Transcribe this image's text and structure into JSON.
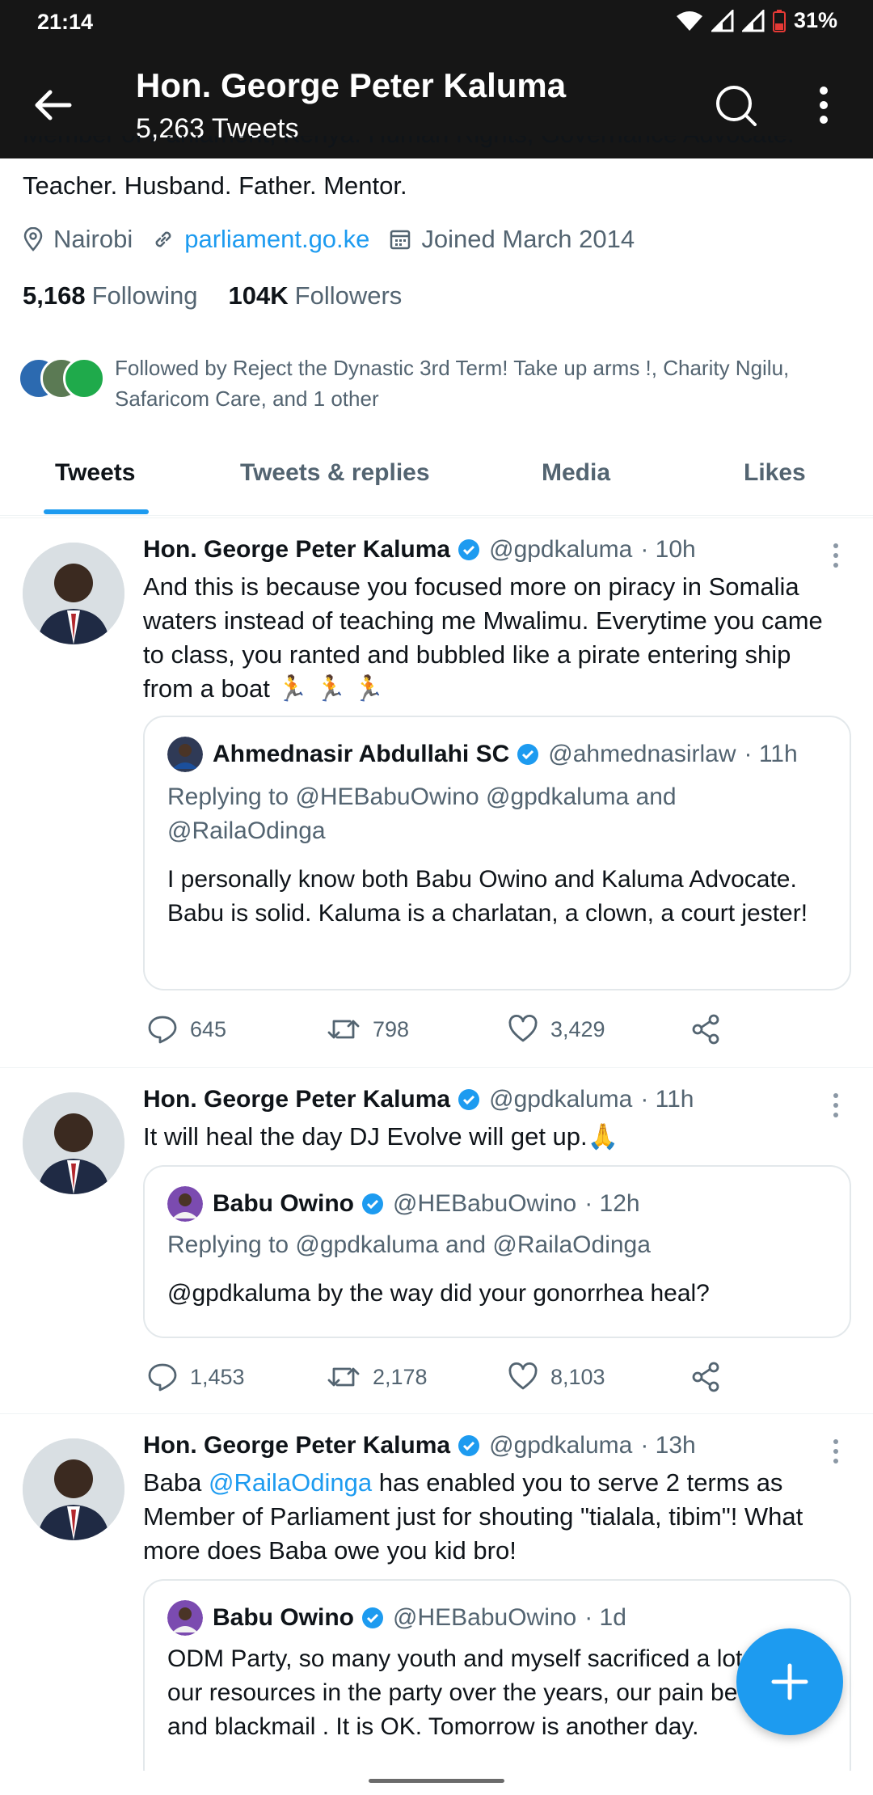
{
  "status_bar": {
    "time": "21:14",
    "battery": "31%"
  },
  "header": {
    "title": "Hon. George Peter Kaluma",
    "subtitle": "5,263 Tweets"
  },
  "profile": {
    "bio_partial": "Member of Parliament, Kenya. Human Rights, Governance Advocate.",
    "bio_line": "Teacher. Husband. Father. Mentor.",
    "location": "Nairobi",
    "website": "parliament.go.ke",
    "joined": "Joined March 2014",
    "following_count": "5,168",
    "following_label": "Following",
    "followers_count": "104K",
    "followers_label": "Followers",
    "followed_by": "Followed by Reject the Dynastic 3rd Term! Take up arms !, Charity Ngilu, Safaricom Care, and 1 other"
  },
  "tabs": [
    {
      "label": "Tweets",
      "active": true
    },
    {
      "label": "Tweets & replies",
      "active": false
    },
    {
      "label": "Media",
      "active": false
    },
    {
      "label": "Likes",
      "active": false
    }
  ],
  "tweets": [
    {
      "name": "Hon. George Peter Kaluma",
      "handle": "@gpdkaluma",
      "time": "· 10h",
      "text": "And this is because you focused more on piracy in Somalia waters instead of teaching me Mwalimu. Everytime you came to class, you ranted and bubbled like a pirate entering ship from a boat 🏃 🏃 🏃",
      "quote": {
        "name": "Ahmednasir Abdullahi SC",
        "handle": "@ahmednasirlaw",
        "time": "· 11h",
        "reply": "Replying to @HEBabuOwino @gpdkaluma and @RailaOdinga",
        "text": "I personally know both Babu Owino and Kaluma Advocate. Babu is solid. Kaluma is a charlatan, a clown, a court jester!"
      },
      "replies": "645",
      "retweets": "798",
      "likes": "3,429"
    },
    {
      "name": "Hon. George Peter Kaluma",
      "handle": "@gpdkaluma",
      "time": "· 11h",
      "text": "It will heal the day DJ Evolve will get up.🙏",
      "quote": {
        "name": "Babu Owino",
        "handle": "@HEBabuOwino",
        "time": "· 12h",
        "reply": "Replying to @gpdkaluma and @RailaOdinga",
        "text": "@gpdkaluma by the way did your gonorrhea heal?"
      },
      "replies": "1,453",
      "retweets": "2,178",
      "likes": "8,103"
    },
    {
      "name": "Hon. George Peter Kaluma",
      "handle": "@gpdkaluma",
      "time": "· 13h",
      "text_before": "Baba ",
      "text_mention": "@RailaOdinga",
      "text_after": " has enabled you to serve 2 terms as Member of Parliament just for shouting \"tialala, tibim\"! What more does Baba owe you kid bro!",
      "quote": {
        "name": "Babu Owino",
        "handle": "@HEBabuOwino",
        "time": "· 1d",
        "text": "ODM Party, so many youth and myself sacrificed a lot, used our resources in the party over the years, our pain betrayal and blackmail . It is OK. Tomorrow is another day."
      }
    }
  ],
  "colors": {
    "accent": "#1d9bf0",
    "header_bg": "#161616",
    "muted": "#536471"
  }
}
